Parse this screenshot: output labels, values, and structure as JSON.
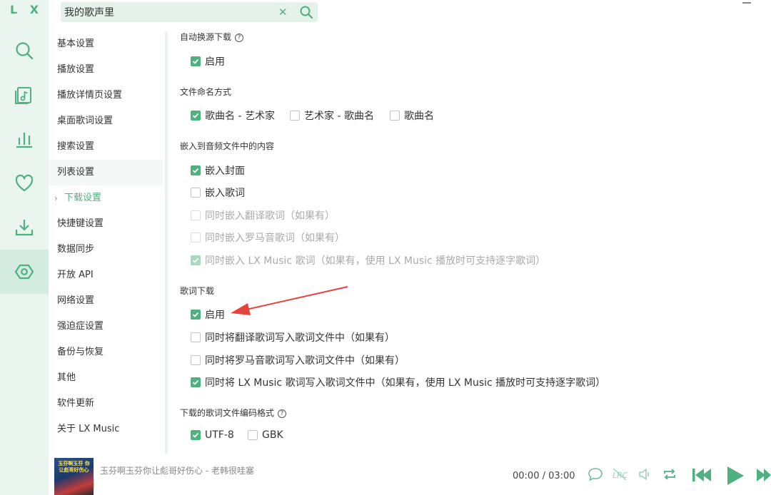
{
  "app": {
    "logo": "L X"
  },
  "search": {
    "value": "我的歌声里"
  },
  "rail": [
    "search-icon",
    "music-list-icon",
    "chart-icon",
    "heart-icon",
    "download-icon",
    "settings-icon"
  ],
  "nav": {
    "items": [
      {
        "label": "基本设置"
      },
      {
        "label": "播放设置"
      },
      {
        "label": "播放详情页设置"
      },
      {
        "label": "桌面歌词设置"
      },
      {
        "label": "搜索设置"
      },
      {
        "label": "列表设置"
      },
      {
        "label": "下载设置"
      },
      {
        "label": "快捷键设置"
      },
      {
        "label": "数据同步"
      },
      {
        "label": "开放 API"
      },
      {
        "label": "网络设置"
      },
      {
        "label": "强迫症设置"
      },
      {
        "label": "备份与恢复"
      },
      {
        "label": "其他"
      },
      {
        "label": "软件更新"
      },
      {
        "label": "关于 LX Music"
      }
    ]
  },
  "download": {
    "auto_switch": {
      "title": "自动换源下载",
      "enable": "启用"
    },
    "naming": {
      "title": "文件命名方式",
      "opt1": "歌曲名 - 艺术家",
      "opt2": "艺术家 - 歌曲名",
      "opt3": "歌曲名"
    },
    "embed": {
      "title": "嵌入到音频文件中的内容",
      "cover": "嵌入封面",
      "lyric": "嵌入歌词",
      "tlyric": "同时嵌入翻译歌词（如果有）",
      "rlyric": "同时嵌入罗马音歌词（如果有）",
      "lxlyric": "同时嵌入 LX Music 歌词（如果有，使用 LX Music 播放时可支持逐字歌词）"
    },
    "lyric_download": {
      "title": "歌词下载",
      "enable": "启用",
      "tlyric": "同时将翻译歌词写入歌词文件中（如果有）",
      "rlyric": "同时将罗马音歌词写入歌词文件中（如果有）",
      "lxlyric": "同时将 LX Music 歌词写入歌词文件中（如果有，使用 LX Music 播放时可支持逐字歌词）"
    },
    "encoding": {
      "title": "下载的歌词文件编码格式",
      "utf8": "UTF-8",
      "gbk": "GBK"
    }
  },
  "player": {
    "cover_text": "玉芬啊玉芬 你让彪哥好伤心",
    "song": "玉芬啊玉芬你让彪哥好伤心 - 老韩很哇塞",
    "time": "00:00  /  03:00"
  },
  "colors": {
    "accent": "#4fb080",
    "arrow": "#e8423f"
  }
}
